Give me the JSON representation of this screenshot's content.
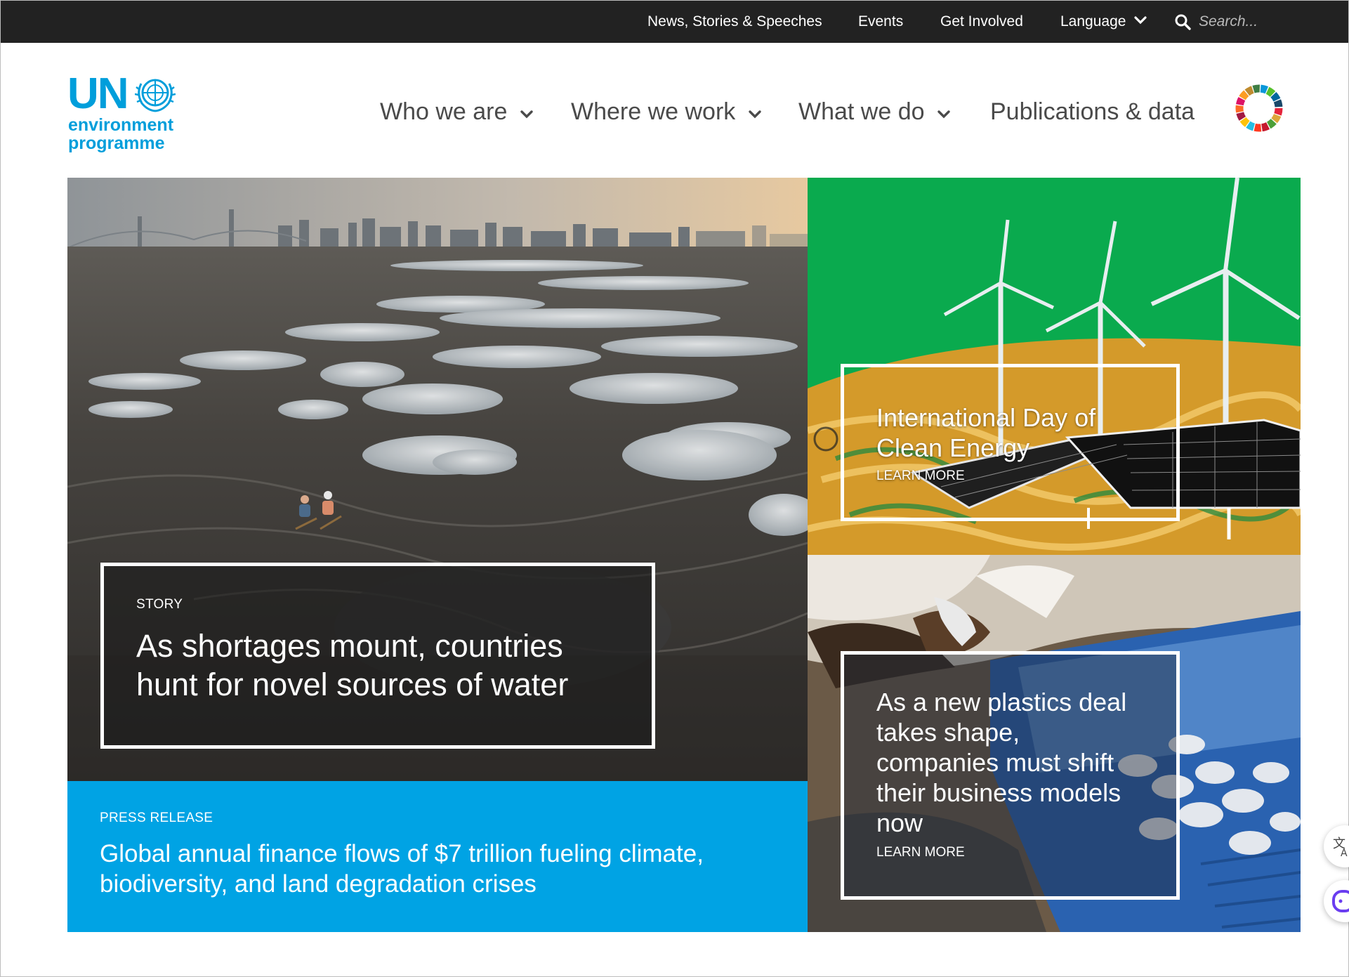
{
  "topbar": {
    "links": [
      "News, Stories & Speeches",
      "Events",
      "Get Involved"
    ],
    "language_label": "Language",
    "search_placeholder": "Search..."
  },
  "logo": {
    "abbr": "UN",
    "line1": "environment",
    "line2": "programme"
  },
  "nav": {
    "items": [
      {
        "label": "Who we are",
        "has_dropdown": true
      },
      {
        "label": "Where we work",
        "has_dropdown": true
      },
      {
        "label": "What we do",
        "has_dropdown": true
      },
      {
        "label": "Publications & data",
        "has_dropdown": false
      }
    ]
  },
  "hero": {
    "main": {
      "kicker": "STORY",
      "headline": "As shortages mount, countries hunt for novel sources of water"
    },
    "press": {
      "kicker": "PRESS RELEASE",
      "headline": "Global annual finance flows of $7 trillion fueling climate, biodiversity, and land degradation crises"
    },
    "energy": {
      "headline": "International Day of Clean Energy",
      "cta": "LEARN MORE"
    },
    "plastics": {
      "headline": "As a new plastics deal takes shape, companies must shift their business models now",
      "cta": "LEARN MORE"
    }
  },
  "colors": {
    "topbar_bg": "#222222",
    "brand_blue": "#009edb",
    "press_blue": "#00a3e4",
    "energy_green": "#0aaa4e"
  },
  "icons": [
    "search-icon",
    "chevron-down-icon",
    "un-emblem-icon",
    "sdg-wheel-icon",
    "translate-icon",
    "assistant-icon"
  ]
}
